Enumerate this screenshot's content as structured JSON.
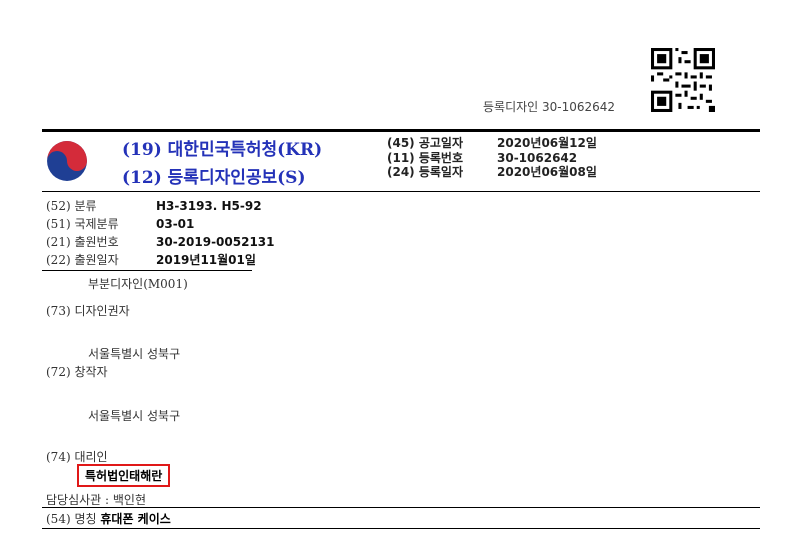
{
  "header": {
    "registration_id": "등록디자인 30-1062642"
  },
  "office": {
    "line1": "(19) 대한민국특허청(KR)",
    "line2": "(12) 등록디자인공보(S)"
  },
  "publication": {
    "rows": [
      {
        "key": "(45) 공고일자",
        "value": "2020년06월12일"
      },
      {
        "key": "(11) 등록번호",
        "value": "30-1062642"
      },
      {
        "key": "(24) 등록일자",
        "value": "2020년06월08일"
      }
    ]
  },
  "biblio": {
    "rows": [
      {
        "key": "(52) 분류",
        "value": "H3-3193. H5-92"
      },
      {
        "key": "(51) 국제분류",
        "value": "03-01"
      },
      {
        "key": "(21) 출원번호",
        "value": "30-2019-0052131"
      },
      {
        "key": "(22) 출원일자",
        "value": "2019년11월01일"
      }
    ],
    "partial_design": "부분디자인(M001)",
    "designer_label": "(73) 디자인권자",
    "designer_address": "서울특별시 성북구",
    "creator_label": "(72) 창작자",
    "creator_address": "서울특별시 성북구",
    "agent_label": "(74) 대리인",
    "agent_name": "특허법인태해란",
    "examiner": "담당심사관 : 백인현",
    "title_label": "(54) 명칭",
    "title_value": "휴대폰 케이스"
  },
  "colors": {
    "office_blue": "#2432b8",
    "highlight_red": "#e01818",
    "logo_red": "#d42b3a",
    "logo_blue": "#1f3f94"
  }
}
